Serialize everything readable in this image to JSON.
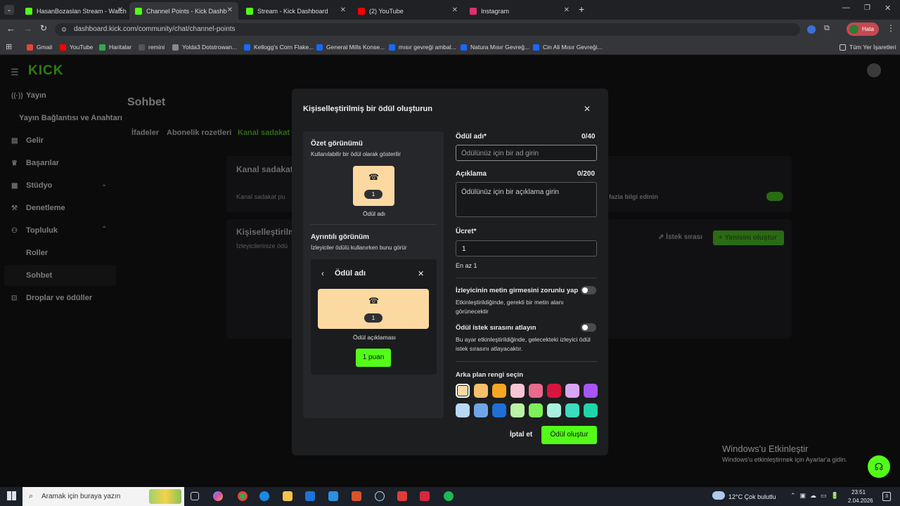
{
  "browser": {
    "tabs": [
      {
        "title": "HasanBozaslan Stream - Watch",
        "favicon_color": "#53fc18"
      },
      {
        "title": "Channel Points - Kick Dashboard",
        "favicon_color": "#53fc18"
      },
      {
        "title": "Stream - Kick Dashboard",
        "favicon_color": "#53fc18"
      },
      {
        "title": "(2) YouTube",
        "favicon_color": "#ff0000"
      },
      {
        "title": "Instagram",
        "favicon_color": "#e1306c"
      }
    ],
    "new_tab": "+",
    "url": "dashboard.kick.com/community/chat/channel-points",
    "profile_label": "Hata",
    "bookmarks": [
      "Gmail",
      "YouTube",
      "Haritalar",
      "remini",
      "Yolda3 Dotstrowan...",
      "Kellogg's Corn Flake...",
      "General Mills Konse...",
      "mısır gevreği ambal...",
      "Natura Mısır Gevreğ...",
      "Cin Ali Mısır Gevreği..."
    ],
    "all_bookmarks": "Tüm Yer İşaretleri"
  },
  "sidebar": {
    "logo": "KICK",
    "items": [
      {
        "label": "Yayın",
        "icon": "broadcast-icon"
      },
      {
        "label": "Yayın Bağlantısı ve Anahtarı",
        "icon": ""
      },
      {
        "label": "Gelir",
        "icon": "wallet-icon"
      },
      {
        "label": "Başarılar",
        "icon": "trophy-icon"
      },
      {
        "label": "Stüdyo",
        "icon": "studio-icon"
      },
      {
        "label": "Denetleme",
        "icon": "hammer-icon"
      },
      {
        "label": "Topluluk",
        "icon": "community-icon"
      },
      {
        "label": "Roller",
        "icon": ""
      },
      {
        "label": "Sohbet",
        "icon": ""
      },
      {
        "label": "Droplar ve ödüller",
        "icon": "gift-icon"
      }
    ]
  },
  "background_page": {
    "title": "Sohbet",
    "tabs": [
      "İfadeler",
      "Abonelik rozetleri",
      "Kanal sadakat p"
    ],
    "section1_title": "Kanal sadakat",
    "section1_text": "Kanal sadakat pu",
    "section1_link": "fazla bilgi edinin",
    "section2_title": "Kişiselleştirilm",
    "section2_text": "İzleyicilerinize ödü",
    "queue_button": "İstek sırası",
    "new_button": "Yenisini oluştur"
  },
  "modal": {
    "title": "Kişiselleştirilmiş bir ödül oluşturun",
    "summary_title": "Özet görünümü",
    "summary_desc": "Kullanılabilir bir ödül olarak gösterilir",
    "cost_pill": "1",
    "reward_name_preview": "Ödül adı",
    "detail_title": "Ayrıntılı görünüm",
    "detail_desc": "İzleyiciler ödülü kullanırken bunu görür",
    "detail_header": "Ödül adı",
    "detail_desc_preview": "Ödül açıklaması",
    "points_button": "1 puan",
    "name_label": "Ödül adı*",
    "name_count": "0/40",
    "name_placeholder": "Ödülünüz için bir ad girin",
    "desc_label": "Açıklama",
    "desc_count": "0/200",
    "desc_placeholder": "Ödülünüz için bir açıklama girin",
    "cost_label": "Ücret*",
    "cost_value": "1",
    "cost_hint": "En az 1",
    "require_text_label": "İzleyicinin metin girmesini zorunlu yap",
    "require_text_desc": "Etkinleştirildiğinde, gerekli bir metin alanı görünecektir",
    "skip_queue_label": "Ödül istek sırasını atlayın",
    "skip_queue_desc": "Bu ayar etkinleştirildiğinde, gelecekteki izleyici ödül istek sırasını atlayacaktır.",
    "bg_color_label": "Arka plan rengi seçin",
    "colors": [
      "#fbd9a1",
      "#f7c06a",
      "#f5a623",
      "#f6c6d3",
      "#e96a8d",
      "#d7153d",
      "#d9a6f5",
      "#a855f7",
      "#b9d7f7",
      "#6fa6e8",
      "#1f6fd6",
      "#b8f5a5",
      "#7bf05a",
      "#a8f0e0",
      "#3ddbc0",
      "#1fd6a8"
    ],
    "cancel": "İptal et",
    "submit": "Ödül oluştur"
  },
  "watermark": {
    "line1": "Windows'u Etkinleştir",
    "line2": "Windows'u etkinleştirmek için Ayarlar'a gidin."
  },
  "taskbar": {
    "search_placeholder": "Aramak için buraya yazın",
    "weather": "12°C  Çok bulutlu",
    "time": "23:51",
    "date": "2.04.2026"
  }
}
